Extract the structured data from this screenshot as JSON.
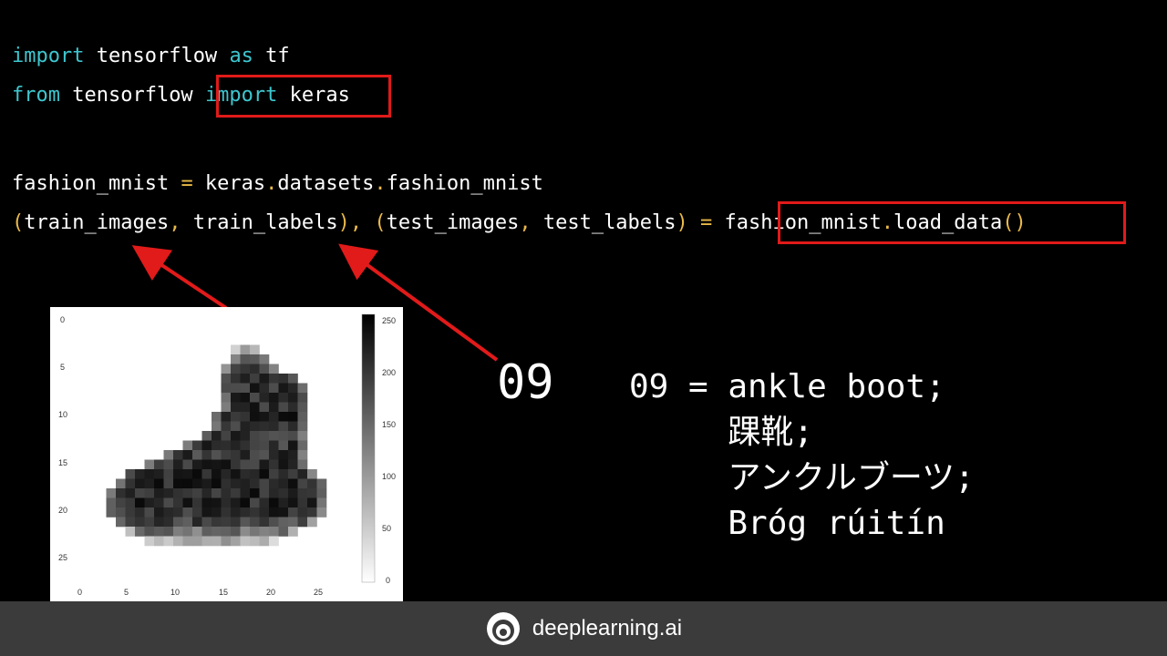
{
  "code": {
    "line1": {
      "kw1": "import",
      "t1": " tensorflow ",
      "kw2": "as",
      "t2": " tf"
    },
    "line2": {
      "kw1": "from",
      "t1": " tensorflow ",
      "kw2": "import",
      "t2": " keras"
    },
    "line3": {
      "t1": "fashion_mnist ",
      "op1": "=",
      "t2": " keras",
      "op2": ".",
      "t3": "datasets",
      "op3": ".",
      "t4": "fashion_mnist"
    },
    "line4": {
      "p1": "(",
      "t1": "train_images",
      "c1": ",",
      "t2": " train_labels",
      "p2": ")",
      "c2": ",",
      "p3": " (",
      "t3": "test_images",
      "c3": ",",
      "t4": " test_labels",
      "p4": ")",
      "eq": " = ",
      "t5": "fashion_mnist",
      "dot": ".",
      "t6": "load_data",
      "p5": "()"
    }
  },
  "plot": {
    "x_ticks": [
      "0",
      "5",
      "10",
      "15",
      "20",
      "25"
    ],
    "y_ticks": [
      "0",
      "5",
      "10",
      "15",
      "20",
      "25"
    ],
    "colorbar_ticks": [
      "250",
      "200",
      "150",
      "100",
      "50",
      "0"
    ],
    "colormap": "gray_r"
  },
  "label_number": "09",
  "translations": {
    "line1": "09 = ankle boot;",
    "line2": "     踝靴;",
    "line3": "     アンクルブーツ;",
    "line4": "     Bróg rúitín"
  },
  "footer": {
    "brand": "deeplearning.ai"
  },
  "colors": {
    "keyword": "#3ec6cf",
    "operator": "#e9b949",
    "highlight": "#e11a1a",
    "footer_bg": "#3b3b3b"
  }
}
